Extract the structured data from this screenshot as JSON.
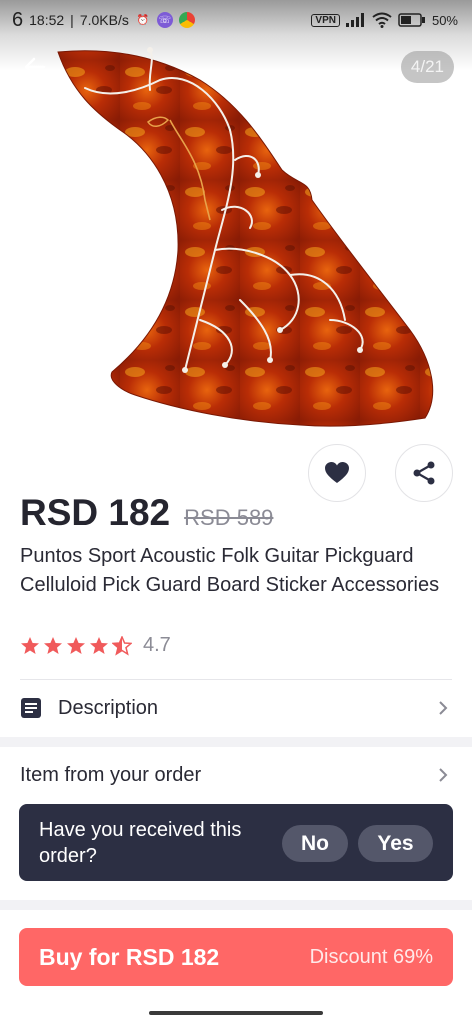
{
  "status_bar": {
    "time": "18:52",
    "net_speed": "7.0KB/s",
    "left_digit": "6",
    "vpn_label": "VPN",
    "battery": "50%"
  },
  "gallery": {
    "counter": "4/21"
  },
  "product": {
    "price": "RSD 182",
    "old_price": "RSD 589",
    "title": "Puntos Sport Acoustic Folk Guitar Pickguard Celluloid Pick Guard Board Sticker Accessories",
    "rating_value": "4.7",
    "rating_stars": 4.7
  },
  "description": {
    "label": "Description"
  },
  "order_section": {
    "label": "Item from your order",
    "question": "Have you received this order?",
    "no_label": "No",
    "yes_label": "Yes"
  },
  "buy": {
    "label": "Buy for RSD 182",
    "discount": "Discount 69%"
  },
  "colors": {
    "accent": "#ff6766",
    "star": "#f05a5b",
    "card_dark": "#2c2f43"
  }
}
